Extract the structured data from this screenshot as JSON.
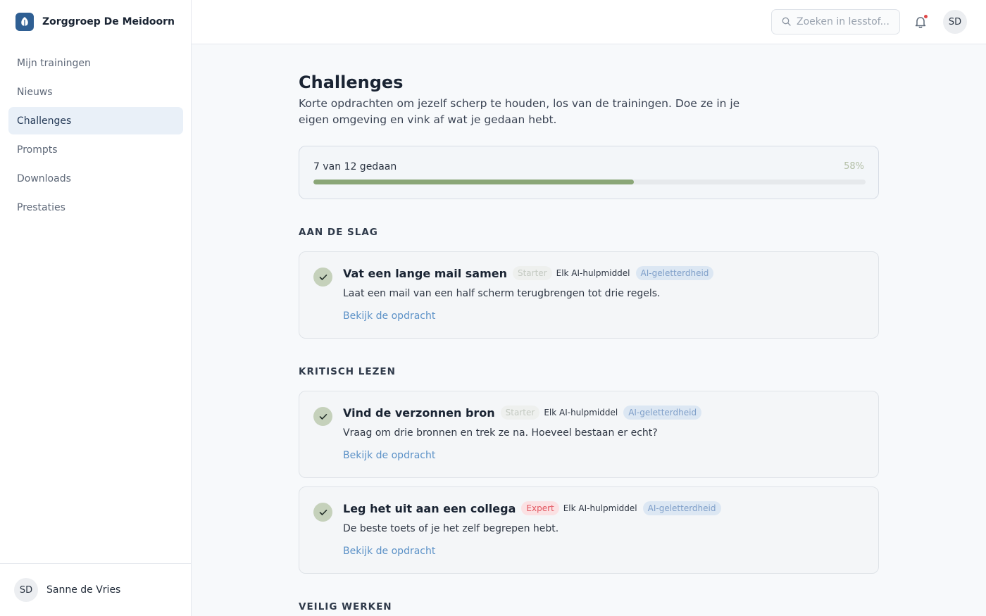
{
  "brand": {
    "name": "Zorggroep De Meidoorn",
    "logo_icon": "leaf-icon",
    "logo_color": "#2f5f93"
  },
  "sidebar": {
    "items": [
      {
        "label": "Mijn trainingen",
        "active": false
      },
      {
        "label": "Nieuws",
        "active": false
      },
      {
        "label": "Challenges",
        "active": true
      },
      {
        "label": "Prompts",
        "active": false
      },
      {
        "label": "Downloads",
        "active": false
      },
      {
        "label": "Prestaties",
        "active": false
      }
    ],
    "user": {
      "initials": "SD",
      "name": "Sanne de Vries"
    }
  },
  "topbar": {
    "search_placeholder": "Zoeken in lesstof...",
    "notification_icon": "bell-icon",
    "avatar_initials": "SD"
  },
  "page": {
    "title": "Challenges",
    "description": "Korte opdrachten om jezelf scherp te houden, los van de trainingen. Doe ze in je eigen omgeving en vink af wat je gedaan hebt."
  },
  "progress": {
    "label": "7 van 12 gedaan",
    "percent_label": "58%",
    "fraction": 0.58,
    "color": "#8aa677"
  },
  "sections": [
    {
      "heading": "AAN DE SLAG",
      "challenges": [
        {
          "title": "Vat een lange mail samen",
          "level": "Starter",
          "tool": "Elk AI-hulpmiddel",
          "topic": "AI-geletterdheid",
          "description": "Laat een mail van een half scherm terugbrengen tot drie regels.",
          "link": "Bekijk de opdracht",
          "done": true
        }
      ]
    },
    {
      "heading": "KRITISCH LEZEN",
      "challenges": [
        {
          "title": "Vind de verzonnen bron",
          "level": "Starter",
          "tool": "Elk AI-hulpmiddel",
          "topic": "AI-geletterdheid",
          "description": "Vraag om drie bronnen en trek ze na. Hoeveel bestaan er echt?",
          "link": "Bekijk de opdracht",
          "done": true
        },
        {
          "title": "Leg het uit aan een collega",
          "level": "Expert",
          "tool": "Elk AI-hulpmiddel",
          "topic": "AI-geletterdheid",
          "description": "De beste toets of je het zelf begrepen hebt.",
          "link": "Bekijk de opdracht",
          "done": true
        }
      ]
    },
    {
      "heading": "VEILIG WERKEN",
      "challenges": []
    }
  ]
}
